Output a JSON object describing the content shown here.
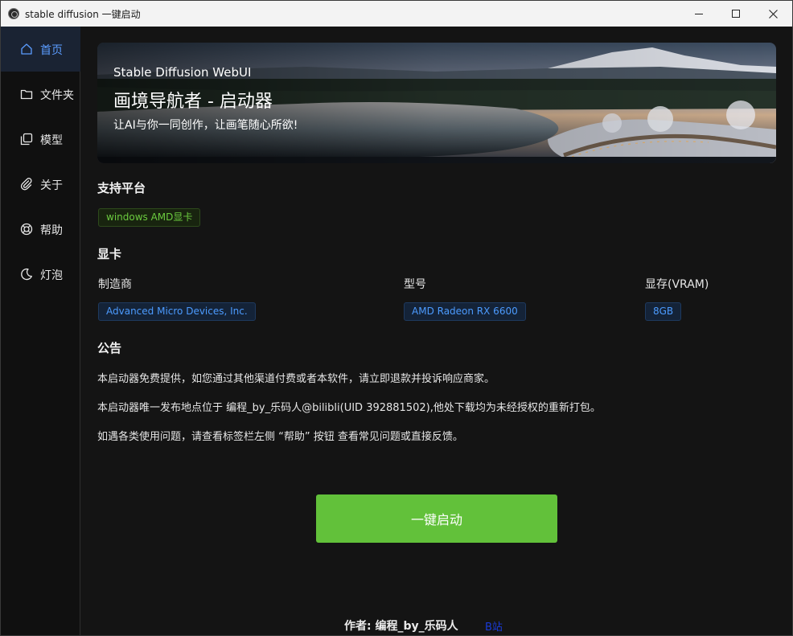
{
  "window": {
    "title": "stable diffusion 一键启动"
  },
  "sidebar": {
    "items": [
      {
        "label": "首页",
        "icon": "home-icon",
        "active": true
      },
      {
        "label": "文件夹",
        "icon": "folder-icon"
      },
      {
        "label": "模型",
        "icon": "model-icon"
      },
      {
        "label": "关于",
        "icon": "paperclip-icon"
      },
      {
        "label": "帮助",
        "icon": "lifebuoy-icon"
      },
      {
        "label": "灯泡",
        "icon": "moon-icon"
      }
    ]
  },
  "banner": {
    "subtitle": "Stable Diffusion WebUI",
    "title": "画境导航者 - 启动器",
    "slogan": "让AI与你一同创作，让画笔随心所欲!"
  },
  "platform": {
    "heading": "支持平台",
    "tag": "windows AMD显卡"
  },
  "gpu": {
    "heading": "显卡",
    "vendor_label": "制造商",
    "vendor_value": "Advanced Micro Devices, Inc.",
    "model_label": "型号",
    "model_value": "AMD Radeon RX 6600",
    "vram_label": "显存(VRAM)",
    "vram_value": "8GB"
  },
  "notice": {
    "heading": "公告",
    "lines": [
      "本启动器免费提供，如您通过其他渠道付费或者本软件，请立即退款并投诉响应商家。",
      "本启动器唯一发布地点位于 编程_by_乐码人@bilibli(UID 392881502),他处下载均为未经授权的重新打包。",
      "如遇各类使用问题，请查看标签栏左侧 “帮助” 按钮 查看常见问题或直接反馈。"
    ]
  },
  "launch": {
    "label": "一键启动"
  },
  "footer": {
    "author": "作者: 编程_by_乐码人",
    "link": "B站"
  },
  "colors": {
    "accent_green": "#62c13a",
    "accent_blue": "#4c9bff",
    "active_nav": "#5b9cff"
  }
}
